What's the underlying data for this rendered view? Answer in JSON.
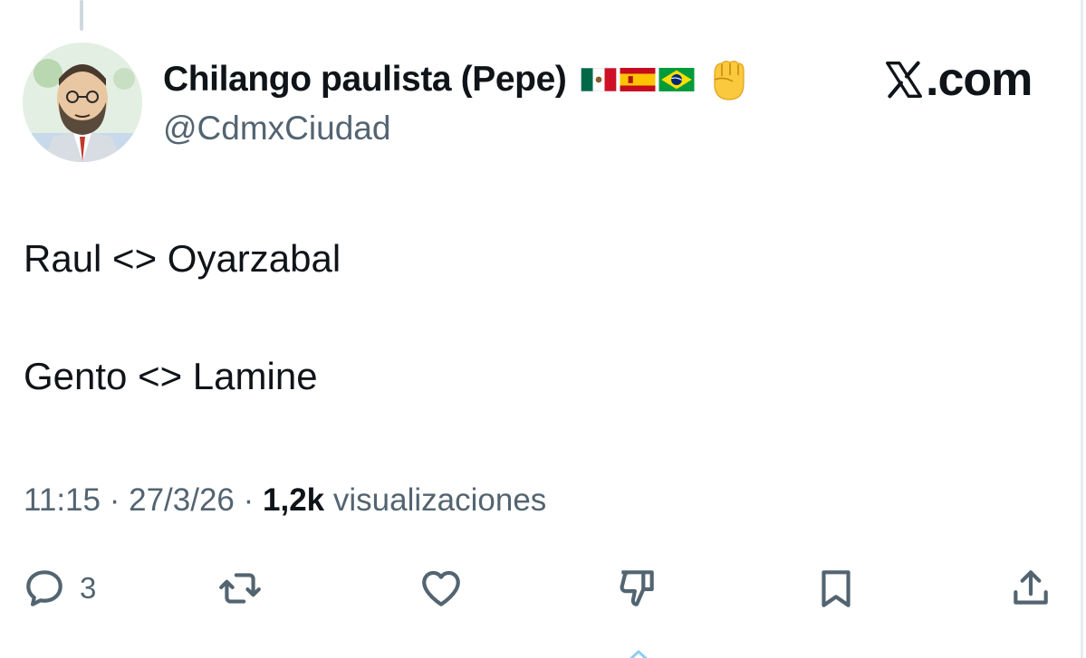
{
  "author": {
    "display_name": "Chilango paulista (Pepe)",
    "handle": "@CdmxCiudad",
    "avatar": "cartoon-portrait-avatar",
    "flags": [
      "mexico-flag",
      "spain-flag",
      "brazil-flag"
    ],
    "emoji": "raised-fist-emoji"
  },
  "brand": {
    "label": ".com",
    "logo": "x-logo-icon"
  },
  "tweet": {
    "lines": [
      "Raul <> Oyarzabal",
      "Gento <> Lamine"
    ]
  },
  "meta": {
    "time": "11:15",
    "date": "27/3/26",
    "separator": "·",
    "views_count": "1,2k",
    "views_label": "visualizaciones"
  },
  "actions": {
    "reply": {
      "icon": "reply-icon",
      "count": "3"
    },
    "retweet": {
      "icon": "retweet-icon"
    },
    "like": {
      "icon": "heart-icon"
    },
    "dislike": {
      "icon": "dislike-icon"
    },
    "bookmark": {
      "icon": "bookmark-icon"
    },
    "share": {
      "icon": "share-icon"
    }
  },
  "colors": {
    "text_primary": "#0f1419",
    "text_secondary": "#536471",
    "background": "#ffffff"
  }
}
